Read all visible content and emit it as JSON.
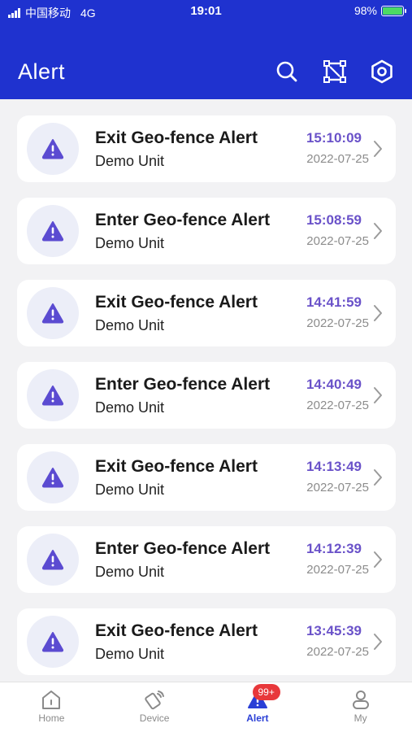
{
  "status_bar": {
    "carrier": "中国移动",
    "network": "4G",
    "time": "19:01",
    "battery_percent": "98%",
    "battery_level": 0.98
  },
  "header": {
    "title": "Alert",
    "background": "#1f32cf",
    "actions": [
      {
        "icon": "search-icon"
      },
      {
        "icon": "crop-select-icon"
      },
      {
        "icon": "settings-hexagon-icon"
      }
    ]
  },
  "alerts": [
    {
      "title": "Exit Geo-fence Alert",
      "unit": "Demo Unit",
      "time": "15:10:09",
      "date": "2022-07-25"
    },
    {
      "title": "Enter Geo-fence Alert",
      "unit": "Demo Unit",
      "time": "15:08:59",
      "date": "2022-07-25"
    },
    {
      "title": "Exit Geo-fence Alert",
      "unit": "Demo Unit",
      "time": "14:41:59",
      "date": "2022-07-25"
    },
    {
      "title": "Enter Geo-fence Alert",
      "unit": "Demo Unit",
      "time": "14:40:49",
      "date": "2022-07-25"
    },
    {
      "title": "Exit Geo-fence Alert",
      "unit": "Demo Unit",
      "time": "14:13:49",
      "date": "2022-07-25"
    },
    {
      "title": "Enter Geo-fence Alert",
      "unit": "Demo Unit",
      "time": "14:12:39",
      "date": "2022-07-25"
    },
    {
      "title": "Exit Geo-fence Alert",
      "unit": "Demo Unit",
      "time": "13:45:39",
      "date": "2022-07-25"
    }
  ],
  "bottom_nav": {
    "items": [
      {
        "label": "Home",
        "icon": "home-icon"
      },
      {
        "label": "Device",
        "icon": "device-icon"
      },
      {
        "label": "Alert",
        "icon": "alert-icon",
        "active": true,
        "badge": "99+"
      },
      {
        "label": "My",
        "icon": "user-icon"
      }
    ]
  },
  "colors": {
    "accent": "#2a3fd6",
    "time_text": "#6a52c9",
    "alert_icon": "#5b4bd1",
    "badge": "#e8383b"
  }
}
